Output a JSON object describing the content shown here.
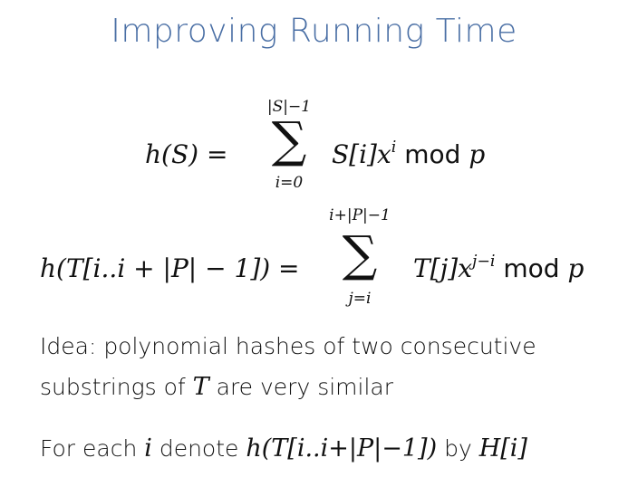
{
  "title": "Improving Running Time",
  "eq1": {
    "lhs": "h(S) = ",
    "sum_upper": "|S|−1",
    "sum_lower": "i=0",
    "rhs_term": "S[i]x",
    "rhs_exp": "i",
    "rhs_mod": " mod ",
    "rhs_p": "p"
  },
  "eq2": {
    "lhs": "h(T[i..i + |P| − 1]) = ",
    "sum_upper": "i+|P|−1",
    "sum_lower": "j=i",
    "rhs_term": "T[j]x",
    "rhs_exp": "j−i",
    "rhs_mod": " mod ",
    "rhs_p": "p"
  },
  "text": {
    "idea_line1": "Idea: polynomial hashes of two consecutive",
    "idea_line2_pre": "substrings of ",
    "idea_line2_T": "T",
    "idea_line2_post": " are very similar",
    "foreach_pre": "For each ",
    "foreach_i": "i",
    "foreach_mid": " denote ",
    "foreach_expr": "h(T[i..i+|P|−1])",
    "foreach_by": " by ",
    "foreach_H": "H[i]"
  }
}
